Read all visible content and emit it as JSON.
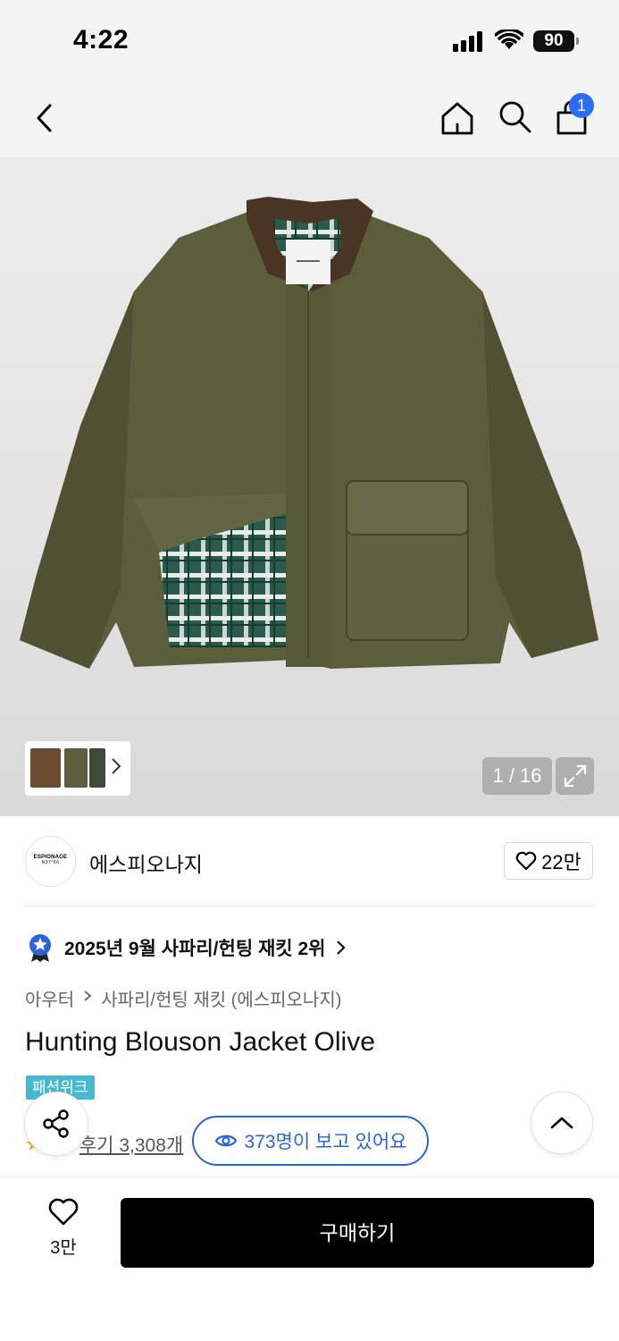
{
  "status_bar": {
    "time": "4:22",
    "battery": "90"
  },
  "nav": {
    "cart_count": "1"
  },
  "gallery": {
    "counter": "1 / 16"
  },
  "brand": {
    "name": "에스피오나지",
    "logo_text": "ESPIONAGE",
    "logo_sub": "N37°56",
    "likes": "22만"
  },
  "ranking": {
    "text": "2025년 9월 사파리/헌팅 재킷 2위"
  },
  "breadcrumb": {
    "category": "아우터",
    "subcategory": "사파리/헌팅 재킷 (에스피오나지)"
  },
  "product": {
    "title": "Hunting Blouson Jacket Olive",
    "event_badge": "패션위크",
    "rating": "5",
    "review_count": "후기 3,308개"
  },
  "viewers": {
    "text": "373명이 보고 있어요"
  },
  "bottom": {
    "wishlist_count": "3만",
    "buy_label": "구매하기"
  },
  "colors": {
    "accent_blue": "#2b63d9",
    "badge_teal": "#46b9cf",
    "cart_badge": "#2b6cf2",
    "buy_button": "#000000"
  },
  "icons": [
    "back-icon",
    "home-icon",
    "search-icon",
    "shopping-bag-icon",
    "expand-icon",
    "heart-icon",
    "medal-icon",
    "share-icon",
    "eye-icon",
    "chevron-up-icon"
  ]
}
